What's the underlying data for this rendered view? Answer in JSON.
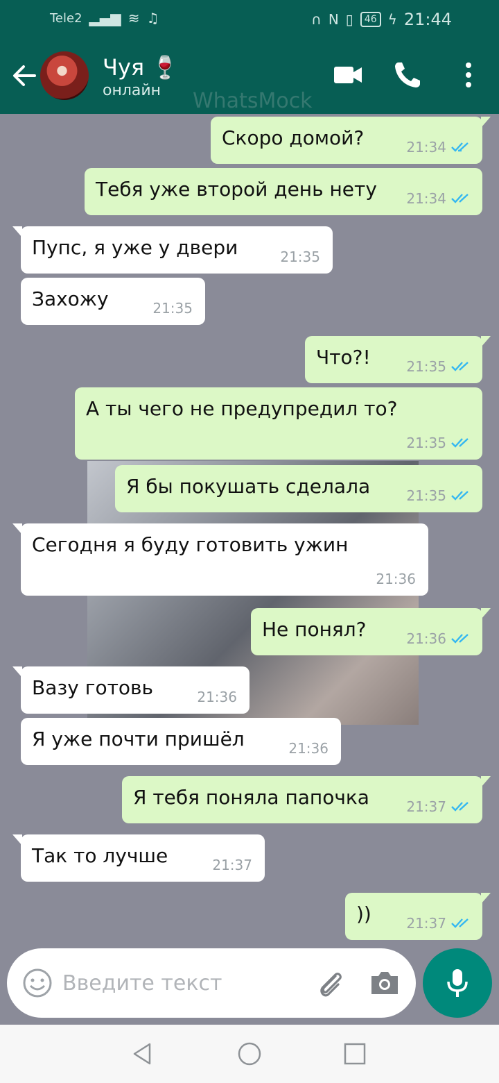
{
  "status_bar": {
    "carrier": "Tele2",
    "battery": "46",
    "time": "21:44",
    "icons": [
      "signal-icon",
      "wifi-icon",
      "music-note-icon",
      "headphones-icon",
      "nfc-icon",
      "vibrate-icon",
      "battery-icon",
      "charging-icon"
    ]
  },
  "header": {
    "name": "Чуя 🍷",
    "status": "онлайн",
    "watermark": "WhatsMock",
    "icons": [
      "back-arrow-icon",
      "video-call-icon",
      "phone-call-icon",
      "more-vert-icon"
    ]
  },
  "messages": [
    {
      "dir": "out",
      "text": "Скоро домой?",
      "time": "21:34",
      "read": true
    },
    {
      "dir": "out",
      "text": "Тебя уже второй день нету",
      "time": "21:34",
      "read": true
    },
    {
      "dir": "in",
      "text": "Пупс, я уже у двери",
      "time": "21:35"
    },
    {
      "dir": "in",
      "text": "Захожу",
      "time": "21:35"
    },
    {
      "dir": "out",
      "text": "Что?!",
      "time": "21:35",
      "read": true
    },
    {
      "dir": "out",
      "text": "А ты чего не предупредил то?",
      "time": "21:35",
      "read": true
    },
    {
      "dir": "out",
      "text": "Я бы покушать сделала",
      "time": "21:35",
      "read": true
    },
    {
      "dir": "in",
      "text": "Сегодня я буду готовить ужин",
      "time": "21:36"
    },
    {
      "dir": "out",
      "text": "Не понял?",
      "time": "21:36",
      "read": true
    },
    {
      "dir": "in",
      "text": "Вазу готовь",
      "time": "21:36"
    },
    {
      "dir": "in",
      "text": "Я уже почти пришёл",
      "time": "21:36"
    },
    {
      "dir": "out",
      "text": "Я тебя поняла папочка",
      "time": "21:37",
      "read": true
    },
    {
      "dir": "in",
      "text": "Так то лучше",
      "time": "21:37"
    },
    {
      "dir": "out",
      "text": "))",
      "time": "21:37",
      "read": true
    }
  ],
  "input": {
    "placeholder": "Введите текст",
    "value": ""
  },
  "colors": {
    "header": "#075e54",
    "outgoing_bubble": "#dcf8c6",
    "incoming_bubble": "#ffffff",
    "chat_background": "#8a8b98",
    "read_ticks": "#34b7f1",
    "mic_button": "#00897b"
  }
}
